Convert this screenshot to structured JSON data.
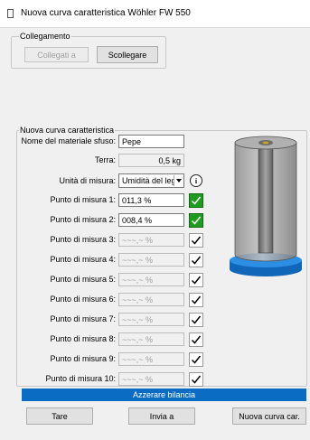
{
  "window": {
    "title": "Nuova curva caratteristica Wöhler FW 550"
  },
  "connection": {
    "legend": "Collegamento",
    "connect_label": "Collegati a",
    "disconnect_label": "Scollegare"
  },
  "curve": {
    "legend": "Nuova curva caratteristica",
    "material_label": "Nome del materiale sfuso:",
    "material_value": "Pepe",
    "tare_label": "Terra:",
    "tare_value": "0,5 kg",
    "unit_label": "Unità di misura:",
    "unit_value": "Umidità del leg",
    "points": [
      {
        "label": "Punto di misura 1:",
        "value": "011,3 %",
        "active": true
      },
      {
        "label": "Punto di misura 2:",
        "value": "008,4 %",
        "active": true
      },
      {
        "label": "Punto di misura 3:",
        "value": "~~~,~ %",
        "active": false
      },
      {
        "label": "Punto di misura 4:",
        "value": "~~~,~ %",
        "active": false
      },
      {
        "label": "Punto di misura 5:",
        "value": "~~~,~ %",
        "active": false
      },
      {
        "label": "Punto di misura 6:",
        "value": "~~~,~ %",
        "active": false
      },
      {
        "label": "Punto di misura 7:",
        "value": "~~~,~ %",
        "active": false
      },
      {
        "label": "Punto di misura 8:",
        "value": "~~~,~ %",
        "active": false
      },
      {
        "label": "Punto di misura 9:",
        "value": "~~~,~ %",
        "active": false
      },
      {
        "label": "Punto di misura 10:",
        "value": "~~~,~ %",
        "active": false
      }
    ]
  },
  "status_bar": {
    "text": "Azzerare bilancia"
  },
  "buttons": {
    "tare": "Tare",
    "send": "Invia a",
    "new_curve": "Nuova curva car."
  },
  "colors": {
    "accent": "#0B6CC4",
    "check_active": "#1F9B1F",
    "container_base": "#1E7FD6"
  }
}
